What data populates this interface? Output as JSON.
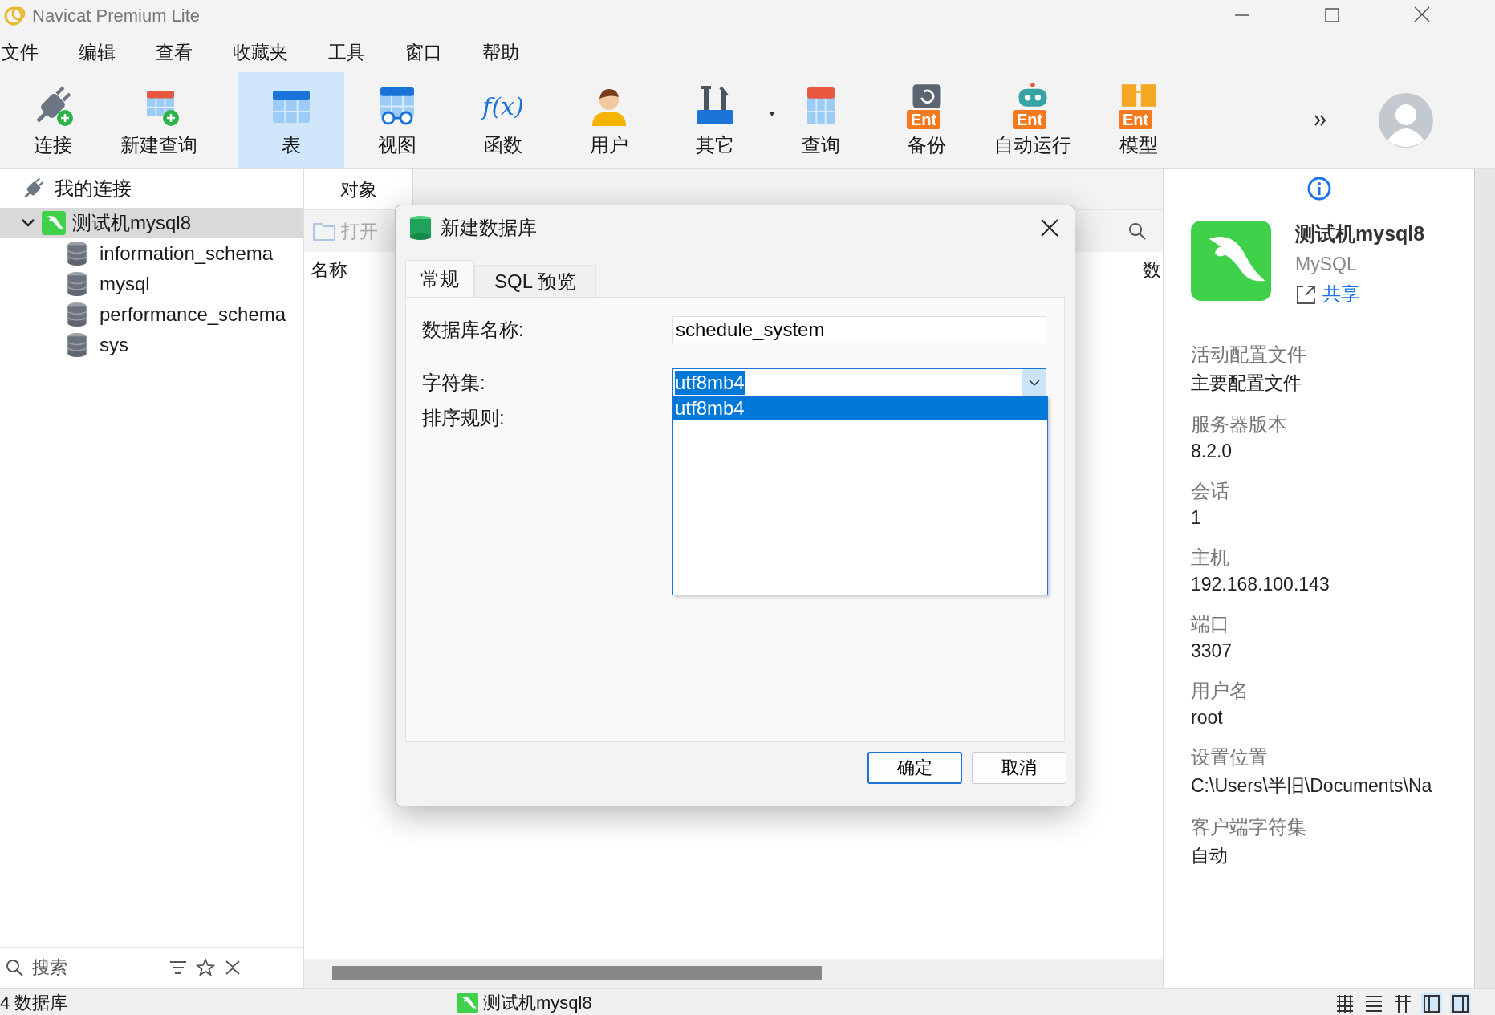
{
  "window": {
    "title": "Navicat Premium Lite"
  },
  "menu": [
    "文件",
    "编辑",
    "查看",
    "收藏夹",
    "工具",
    "窗口",
    "帮助"
  ],
  "toolbar": [
    {
      "label": "连接",
      "selected": false,
      "dropdown": false
    },
    {
      "label": "新建查询",
      "selected": false,
      "dropdown": false
    },
    {
      "label": "表",
      "selected": true,
      "dropdown": false
    },
    {
      "label": "视图",
      "selected": false,
      "dropdown": false
    },
    {
      "label": "函数",
      "selected": false,
      "dropdown": false,
      "glyph": "f(x)"
    },
    {
      "label": "用户",
      "selected": false,
      "dropdown": false
    },
    {
      "label": "其它",
      "selected": false,
      "dropdown": true
    },
    {
      "label": "查询",
      "selected": false,
      "dropdown": false
    },
    {
      "label": "备份",
      "selected": false,
      "dropdown": false,
      "badge": "Ent"
    },
    {
      "label": "自动运行",
      "selected": false,
      "dropdown": false,
      "badge": "Ent"
    },
    {
      "label": "模型",
      "selected": false,
      "dropdown": false,
      "badge": "Ent"
    }
  ],
  "sidebar": {
    "title": "我的连接",
    "tree": [
      {
        "label": "测试机mysql8",
        "expanded": true,
        "selected": true,
        "children": [
          {
            "label": "information_schema"
          },
          {
            "label": "mysql"
          },
          {
            "label": "performance_schema"
          },
          {
            "label": "sys"
          }
        ]
      }
    ],
    "search": {
      "placeholder": "搜索"
    }
  },
  "objects": {
    "tab": "对象",
    "toolbar_button": "打开",
    "columns": [
      "名称",
      "数"
    ]
  },
  "dialog": {
    "title": "新建数据库",
    "tabs": [
      {
        "label": "常规",
        "selected": true
      },
      {
        "label": "SQL 预览",
        "selected": false
      }
    ],
    "fields": [
      {
        "kind": "text",
        "label": "数据库名称:",
        "value": "schedule_system"
      },
      {
        "kind": "combo",
        "label": "字符集:",
        "value": "utf8mb4",
        "options": [
          {
            "label": "utf8mb4",
            "selected": true
          }
        ]
      },
      {
        "kind": "hidden",
        "label": "排序规则:"
      }
    ],
    "buttons": [
      {
        "label": "确定",
        "default": true
      },
      {
        "label": "取消",
        "default": false
      }
    ]
  },
  "info": {
    "name": "测试机mysql8",
    "type": "MySQL",
    "share": "共享",
    "items": [
      {
        "label": "活动配置文件",
        "value": "主要配置文件"
      },
      {
        "label": "服务器版本",
        "value": "8.2.0"
      },
      {
        "label": "会话",
        "value": "1"
      },
      {
        "label": "主机",
        "value": "192.168.100.143"
      },
      {
        "label": "端口",
        "value": "3307"
      },
      {
        "label": "用户名",
        "value": "root"
      },
      {
        "label": "设置位置",
        "value": "C:\\Users\\半旧\\Documents\\Na"
      },
      {
        "label": "客户端字符集",
        "value": "自动"
      }
    ]
  },
  "status_bar": {
    "count": "4 数据库",
    "connection": "测试机mysql8"
  }
}
